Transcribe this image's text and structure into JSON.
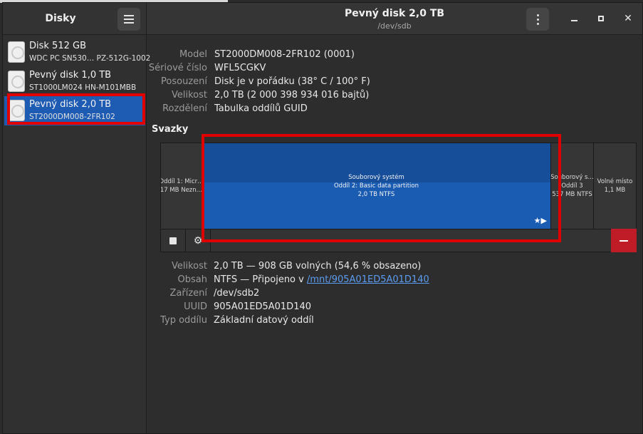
{
  "sidebar": {
    "title": "Disky",
    "disks": [
      {
        "name": "Disk 512 GB",
        "model": "WDC PC SN530… PZ-512G-1002",
        "selected": false
      },
      {
        "name": "Pevný disk 1,0 TB",
        "model": "ST1000LM024 HN-M101MBB",
        "selected": false
      },
      {
        "name": "Pevný disk 2,0 TB",
        "model": "ST2000DM008-2FR102",
        "selected": true
      }
    ]
  },
  "header": {
    "title": "Pevný disk 2,0 TB",
    "subtitle": "/dev/sdb",
    "close_glyph": "✕"
  },
  "drive_info": {
    "model_label": "Model",
    "model": "ST2000DM008-2FR102 (0001)",
    "serial_label": "Sériové číslo",
    "serial": "WFL5CGKV",
    "assessment_label": "Posouzení",
    "assessment": "Disk je v pořádku (38° C / 100° F)",
    "size_label": "Velikost",
    "size": "2,0 TB (2 000 398 934 016 bajtů)",
    "partitioning_label": "Rozdělení",
    "partitioning": "Tabulka oddílů GUID"
  },
  "volumes": {
    "title": "Svazky",
    "partitions": [
      {
        "line1": "Oddíl 1: Micr…",
        "line2": "17 MB Nezn…",
        "line3": ""
      },
      {
        "line1": "Souborový systém",
        "line2": "Oddíl 2: Basic data partition",
        "line3": "2,0 TB NTFS",
        "selected": true,
        "icons": "★▶"
      },
      {
        "line1": "Souborový s…",
        "line2": "Oddíl 3",
        "line3": "537 MB NTFS"
      },
      {
        "line1": "Volné místo",
        "line2": "1,1 MB",
        "line3": ""
      }
    ],
    "gear_glyph": "⚙"
  },
  "volume_info": {
    "size_label": "Velikost",
    "size": "2,0 TB — 908 GB volných (54,6 % obsazeno)",
    "content_label": "Obsah",
    "content_prefix": "NTFS — Připojeno v ",
    "content_link": "/mnt/905A01ED5A01D140",
    "device_label": "Zařízení",
    "device": "/dev/sdb2",
    "uuid_label": "UUID",
    "uuid": "905A01ED5A01D140",
    "type_label": "Typ oddílu",
    "type": "Základní datový oddíl"
  },
  "colors": {
    "accent": "#1e5bb3",
    "highlight": "#e00000",
    "destructive": "#c01c28"
  }
}
